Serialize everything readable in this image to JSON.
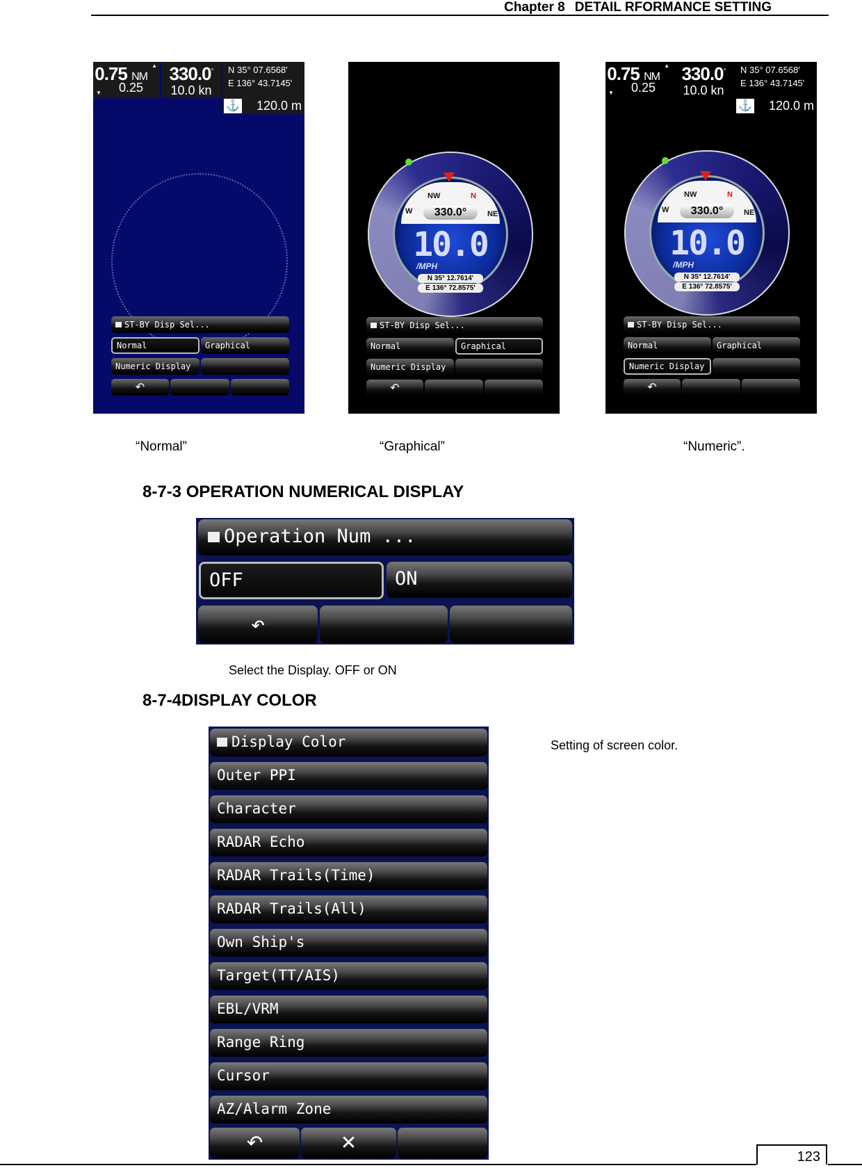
{
  "header": {
    "chapter": "Chapter 8",
    "title": "DETAIL RFORMANCE SETTING"
  },
  "screens": [
    {
      "mode": "normal",
      "caption": "“Normal”",
      "range": "0.75",
      "range_unit": "NM",
      "ring": "0.25",
      "heading": "330.0",
      "heading_deg": "°",
      "speed": "10.0 kn",
      "lat": "N   35° 07.6568'",
      "lon": "E  136° 43.7145'",
      "depth": "120.0 m",
      "menu_title": "ST-BY Disp Sel...",
      "options": [
        "Normal",
        "Graphical",
        "Numeric Display"
      ],
      "selected": "Normal"
    },
    {
      "mode": "graphical",
      "caption": "“Graphical”",
      "gauge": {
        "heading": "330.0°",
        "speed": "10.0",
        "unit": "/MPH",
        "lat": "N  35°   12.7614'",
        "lon": "E 136°   72.8575'",
        "labels": [
          "W",
          "NW",
          "N",
          "NE"
        ]
      },
      "menu_title": "ST-BY Disp Sel...",
      "options": [
        "Normal",
        "Graphical",
        "Numeric Display"
      ],
      "selected": "Graphical"
    },
    {
      "mode": "numeric",
      "caption": "“Numeric”.",
      "range": "0.75",
      "range_unit": "NM",
      "ring": "0.25",
      "heading": "330.0",
      "heading_deg": "°",
      "speed": "10.0 kn",
      "lat": "N   35° 07.6568'",
      "lon": "E  136° 43.7145'",
      "depth": "120.0 m",
      "gauge": {
        "heading": "330.0°",
        "speed": "10.0",
        "unit": "/MPH",
        "lat": "N  35°   12.7614'",
        "lon": "E 136°   72.8575'",
        "labels": [
          "W",
          "NW",
          "N",
          "NE"
        ]
      },
      "menu_title": "ST-BY Disp Sel...",
      "options": [
        "Normal",
        "Graphical",
        "Numeric Display"
      ],
      "selected": "Numeric Display"
    }
  ],
  "icons": {
    "back": "↶",
    "close": "✕",
    "anchor": "⚓"
  },
  "section_873": {
    "heading": "8-7-3 OPERATION NUMERICAL DISPLAY",
    "menu_title": "Operation Num ...",
    "options": [
      "OFF",
      "ON"
    ],
    "selected": "OFF",
    "description": "Select the Display. OFF or ON"
  },
  "section_874": {
    "heading": "8-7-4DISPLAY COLOR",
    "menu_title": "Display Color",
    "items": [
      "Outer PPI",
      "Character",
      "RADAR Echo",
      "RADAR Trails(Time)",
      "RADAR Trails(All)",
      "Own Ship's",
      "Target(TT/AIS)",
      "EBL/VRM",
      "Range Ring",
      "Cursor",
      "AZ/Alarm Zone"
    ],
    "description": "Setting of screen color."
  },
  "footer": {
    "page": "123"
  }
}
